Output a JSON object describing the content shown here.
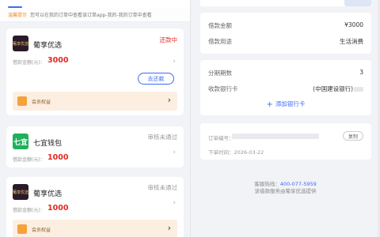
{
  "left": {
    "notice": {
      "tag": "温馨提示",
      "text": "您可以在我的订单中查看该订单app-我的-我的订单中查看"
    },
    "cards": [
      {
        "logo_text": "葡享优选",
        "name": "葡享优选",
        "status": "还款中",
        "amount_label": "借款金额(元)：",
        "amount": "3000",
        "action": "去还款",
        "member_label": "会员权益"
      },
      {
        "logo_text": "七宜",
        "name": "七宜钱包",
        "status": "审核未通过",
        "amount_label": "借款金额(元)：",
        "amount": "1000"
      },
      {
        "logo_text": "葡享优选",
        "name": "葡享优选",
        "status": "审核未通过",
        "amount_label": "借款金额(元)：",
        "amount": "1000",
        "member_label": "会员权益"
      }
    ]
  },
  "right": {
    "loan": {
      "amount_label": "借款金额",
      "amount_value": "¥3000",
      "purpose_label": "借款用途",
      "purpose_value": "生活消费"
    },
    "repay": {
      "installments_label": "分期期数",
      "installments_value": "3",
      "bank_label": "收款银行卡",
      "bank_value": "(中国建设银行)",
      "add_bank": "添加银行卡"
    },
    "order": {
      "order_no_label": "订单编号：",
      "copy_label": "复制",
      "time_label": "下单时间：",
      "time_value": "2026-03-22"
    },
    "footer": {
      "hotline_label": "客服热线：",
      "hotline": "400-077-5959",
      "note": "该借款服务由葡享优选提供"
    }
  },
  "colors": {
    "accent": "#3d6cf0",
    "danger": "#e0312b",
    "member_bg": "#fcefe2"
  }
}
